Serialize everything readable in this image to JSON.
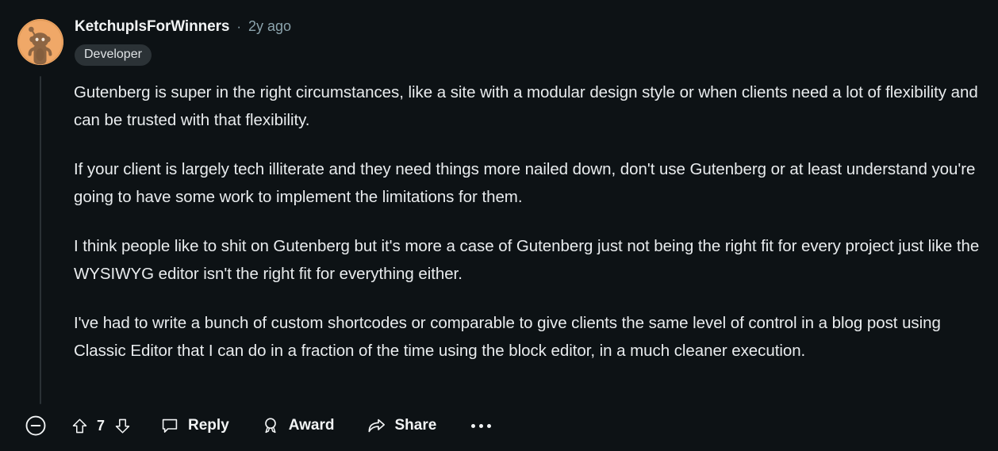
{
  "comment": {
    "author": {
      "username": "KetchupIsForWinners",
      "avatar_icon": "reddit-snoo-avatar",
      "avatar_bg_color": "#f0a868",
      "avatar_fg_color": "#8d6543"
    },
    "separator": "·",
    "timestamp": "2y ago",
    "badge": "Developer",
    "body_paragraphs": [
      "Gutenberg is super in the right circumstances, like a site with a modular design style or when clients need a lot of flexibility and can be trusted with that flexibility.",
      "If your client is largely tech illiterate and they need things more nailed down, don't use Gutenberg or at least understand you're going to have some work to implement the limitations for them.",
      "I think people like to shit on Gutenberg but it's more a case of Gutenberg just not being the right fit for every project just like the WYSIWYG editor isn't the right fit for everything either.",
      "I've had to write a bunch of custom shortcodes or comparable to give clients the same level of control in a blog post using Classic Editor that I can do in a fraction of the time using the block editor, in a much cleaner execution."
    ]
  },
  "actions": {
    "collapse_icon": "minus-circle-icon",
    "upvote_icon": "upvote-arrow-icon",
    "downvote_icon": "downvote-arrow-icon",
    "score": "7",
    "reply_icon": "comment-bubble-icon",
    "reply_label": "Reply",
    "award_icon": "award-medal-icon",
    "award_label": "Award",
    "share_icon": "share-arrow-icon",
    "share_label": "Share",
    "more_icon": "ellipsis-icon"
  },
  "theme": {
    "background": "#0d1215",
    "text_primary": "#e9ecee",
    "text_muted": "#8ba3ac",
    "badge_bg": "#2b3236",
    "thread_line": "#2a3135"
  }
}
